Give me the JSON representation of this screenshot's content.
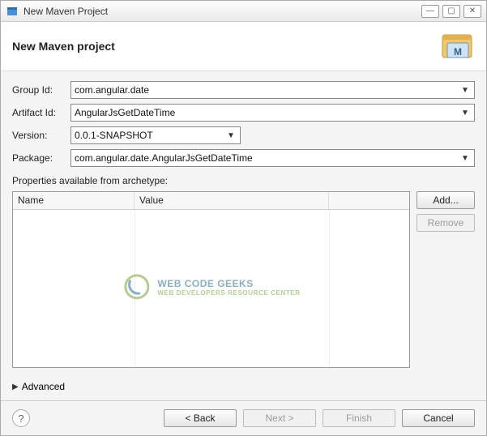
{
  "titlebar": {
    "title": "New Maven Project"
  },
  "header": {
    "title": "New Maven project"
  },
  "form": {
    "group_id": {
      "label": "Group Id:",
      "value": "com.angular.date"
    },
    "artifact_id": {
      "label": "Artifact Id:",
      "value": "AngularJsGetDateTime"
    },
    "version": {
      "label": "Version:",
      "value": "0.0.1-SNAPSHOT"
    },
    "package": {
      "label": "Package:",
      "value": "com.angular.date.AngularJsGetDateTime"
    }
  },
  "properties": {
    "section_label": "Properties available from archetype:",
    "columns": {
      "name": "Name",
      "value": "Value"
    },
    "rows": []
  },
  "side_buttons": {
    "add": "Add...",
    "remove": "Remove"
  },
  "advanced": {
    "label": "Advanced"
  },
  "footer": {
    "back": "< Back",
    "next": "Next >",
    "finish": "Finish",
    "cancel": "Cancel"
  },
  "watermark": {
    "main": "WEB CODE GEEKS",
    "sub": "WEB DEVELOPERS RESOURCE CENTER"
  }
}
